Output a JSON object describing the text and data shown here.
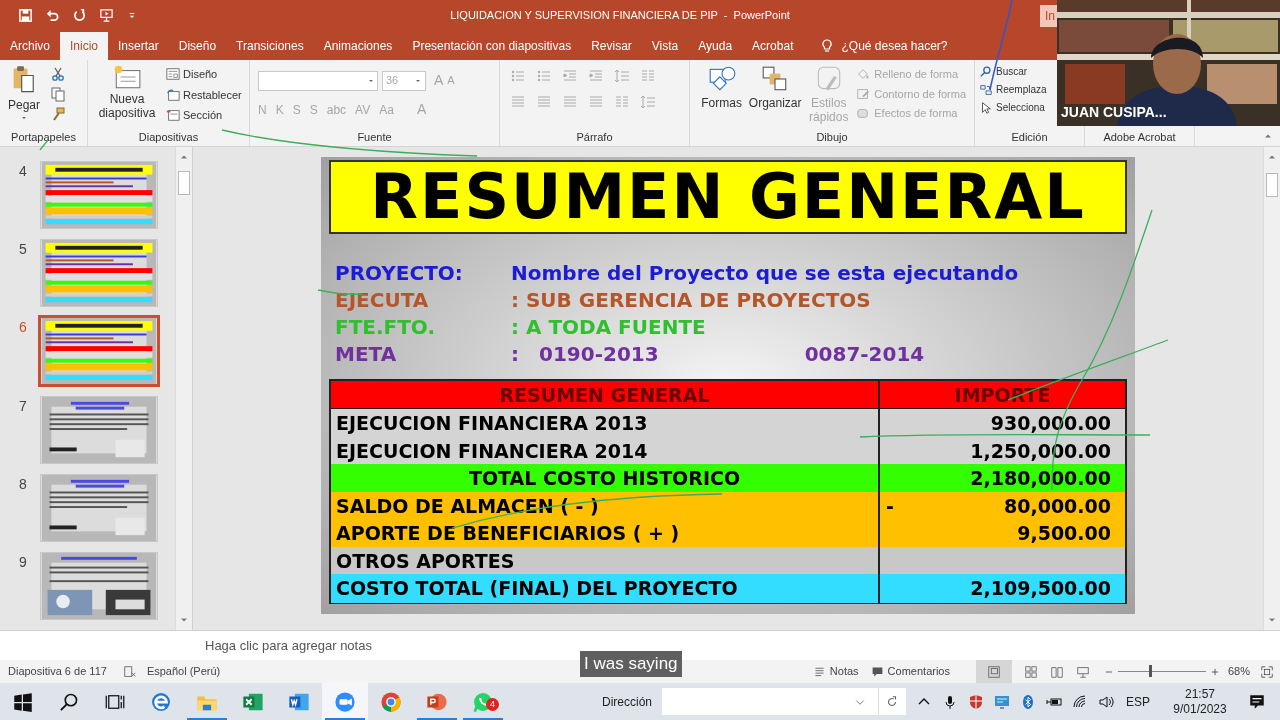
{
  "title_bar": {
    "title": "LIQUIDACION Y SUPERVISION FINANCIERA DE PIP  -  PowerPoint",
    "signin": "In"
  },
  "ribbon_tabs": [
    {
      "label": "Archivo",
      "selected": false
    },
    {
      "label": "Inicio",
      "selected": true
    },
    {
      "label": "Insertar",
      "selected": false
    },
    {
      "label": "Diseño",
      "selected": false
    },
    {
      "label": "Transiciones",
      "selected": false
    },
    {
      "label": "Animaciones",
      "selected": false
    },
    {
      "label": "Presentación con diapositivas",
      "selected": false
    },
    {
      "label": "Revisar",
      "selected": false
    },
    {
      "label": "Vista",
      "selected": false
    },
    {
      "label": "Ayuda",
      "selected": false
    },
    {
      "label": "Acrobat",
      "selected": false
    }
  ],
  "tell_me": "¿Qué desea hacer?",
  "ribbon": {
    "clipboard": {
      "group": "Portapapeles",
      "paste": "Pegar"
    },
    "slides": {
      "group": "Diapositivas",
      "new_slide": "Nueva diapositiva",
      "commands": [
        "Diseño",
        "Restablecer",
        "Sección"
      ]
    },
    "font": {
      "group": "Fuente",
      "disabled": true,
      "size": "36",
      "size_buttons": [
        "A",
        "A"
      ],
      "format_buttons": [
        "N",
        "K",
        "S",
        "S",
        "abc",
        "AV",
        "Aa"
      ],
      "color_button": "A"
    },
    "paragraph": {
      "group": "Párrafo"
    },
    "drawing": {
      "group": "Dibujo",
      "shapes": "Formas",
      "arrange": "Organizar",
      "quick_styles": {
        "label": "Estilos rápidos",
        "disabled": true
      },
      "commands": [
        {
          "label": "Relleno de forma",
          "disabled": true
        },
        {
          "label": "Contorno de forma",
          "disabled": true
        },
        {
          "label": "Efectos de forma",
          "disabled": true
        }
      ]
    },
    "editing": {
      "group": "Edición",
      "commands": [
        "Buscar",
        "Reemplaza",
        "Selecciona"
      ]
    },
    "acrobat": {
      "group": "Adobe Acrobat"
    }
  },
  "video": {
    "name": "JUAN CUSIPA..."
  },
  "thumbnails": [
    {
      "number": "4",
      "kind": "summary",
      "selected": false
    },
    {
      "number": "5",
      "kind": "summary",
      "selected": false
    },
    {
      "number": "6",
      "kind": "summary",
      "selected": true
    },
    {
      "number": "7",
      "kind": "text",
      "selected": false
    },
    {
      "number": "8",
      "kind": "text",
      "selected": false
    },
    {
      "number": "9",
      "kind": "photos",
      "selected": false
    }
  ],
  "slide": {
    "title": "RESUMEN GENERAL",
    "info": [
      {
        "label": "PROYECTO:",
        "values": [
          "Nombre del Proyecto que se esta ejecutando"
        ],
        "color": "#1c1cd4"
      },
      {
        "label": "EJECUTA",
        "values": [
          ": SUB GERENCIA DE PROYECTOS"
        ],
        "color": "#b5562a"
      },
      {
        "label": "FTE.FTO.",
        "values": [
          ": A TODA FUENTE"
        ],
        "color": "#2fbf2f"
      },
      {
        "label": "META",
        "values": [
          ":",
          "0190-2013",
          "0087-2014"
        ],
        "color": "#7030a0"
      }
    ],
    "table": {
      "columns": [
        "RESUMEN GENERAL",
        "IMPORTE"
      ],
      "rows": [
        {
          "kind": "item",
          "label": "EJECUCION FINANCIERA 2013",
          "amount": "930,000.00",
          "color": "#d4d4d4"
        },
        {
          "kind": "item",
          "label": "EJECUCION FINANCIERA 2014",
          "amount": "1,250,000.00",
          "color": "#d4d4d4"
        },
        {
          "kind": "total",
          "label": "TOTAL COSTO HISTORICO",
          "amount": "2,180,000.00",
          "color": "#33ff00"
        },
        {
          "kind": "item",
          "label": "SALDO DE ALMACEN ( - )",
          "sign": "-",
          "amount": "80,000.00",
          "color": "#ffc000"
        },
        {
          "kind": "item",
          "label": "APORTE DE BENEFICIARIOS ( + )",
          "amount": "9,500.00",
          "color": "#ffc000"
        },
        {
          "kind": "item",
          "label": "OTROS APORTES",
          "color": "#c8c8c8"
        },
        {
          "kind": "item",
          "label": "COSTO TOTAL (FINAL) DEL PROYECTO",
          "amount": "2,109,500.00",
          "color": "#33ddff"
        }
      ]
    }
  },
  "notes": {
    "placeholder": "Haga clic para agregar notas"
  },
  "caption": "I was saying",
  "status_bar": {
    "slide": "Diapositiva 6 de 117",
    "language": "Español (Perú)",
    "notes": "Notas",
    "comments": "Comentarios",
    "zoom": "68%",
    "zoom_level": {
      "level": 0.35
    }
  },
  "taskbar": {
    "apps": [
      {
        "kind": "edge",
        "running": false,
        "selected": false
      },
      {
        "kind": "folder",
        "running": true,
        "selected": false
      },
      {
        "kind": "excel",
        "running": false,
        "selected": false
      },
      {
        "kind": "word",
        "running": false,
        "selected": false
      },
      {
        "kind": "zoom",
        "running": true,
        "selected": true
      },
      {
        "kind": "chrome",
        "running": false,
        "selected": false
      },
      {
        "kind": "powerpoint",
        "running": true,
        "selected": false
      },
      {
        "kind": "whatsapp",
        "running": true,
        "selected": false,
        "badge": "4"
      }
    ],
    "address_label": "Dirección",
    "language": "ESP",
    "time": "21:57",
    "date": "9/01/2023"
  }
}
